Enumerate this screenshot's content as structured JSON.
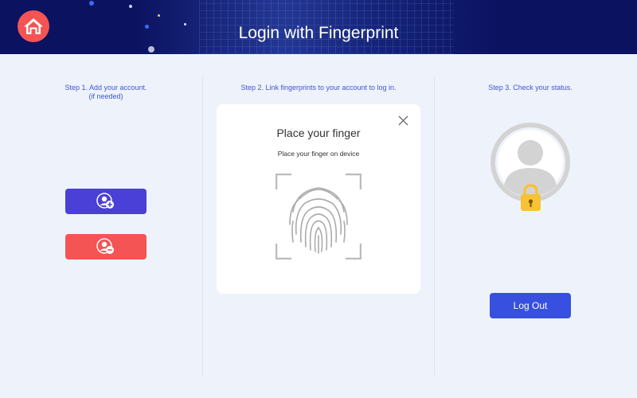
{
  "header": {
    "title": "Login with Fingerprint",
    "home_icon": "home-icon",
    "background_color": "#0b1260",
    "home_button_color": "#f45454"
  },
  "steps": {
    "step1_line1": "Step 1. Add your account.",
    "step1_line2": "(if needed)",
    "step2": "Step 2.  Link fingerprints to your account to log in.",
    "step3": "Step 3. Check your status."
  },
  "account_buttons": {
    "add_icon": "add-user-icon",
    "remove_icon": "remove-user-icon",
    "add_color": "#4a3fd6",
    "remove_color": "#f45454"
  },
  "fingerprint_card": {
    "title": "Place your finger",
    "subtitle": "Place your finger on device",
    "close_icon": "close-icon",
    "fingerprint_icon": "fingerprint-icon"
  },
  "status": {
    "avatar_icon": "user-avatar-icon",
    "lock_icon": "lock-icon",
    "lock_color": "#f7c235"
  },
  "logout": {
    "label": "Log Out",
    "color": "#3850e0"
  },
  "accent_color": "#3d55d8"
}
